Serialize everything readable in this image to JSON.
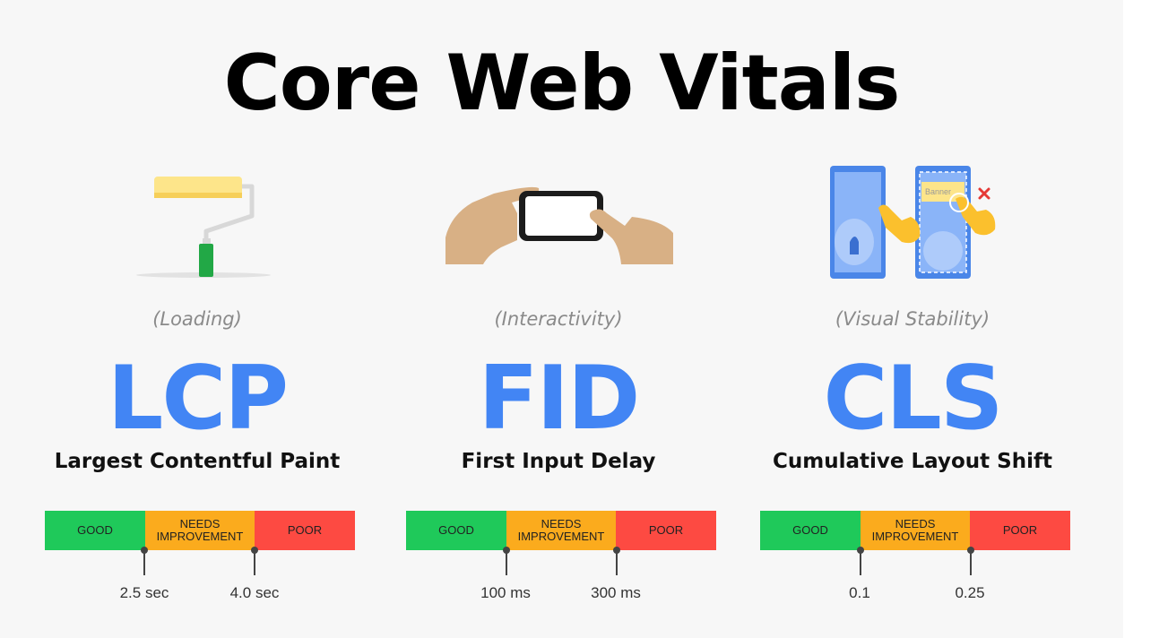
{
  "title": "Core Web Vitals",
  "colors": {
    "accent": "#4285f4",
    "good": "#1fc95a",
    "needs": "#fbab1d",
    "poor": "#fd4a42"
  },
  "bar_labels": {
    "good": "GOOD",
    "needs_1": "NEEDS",
    "needs_2": "IMPROVEMENT",
    "poor": "POOR"
  },
  "metrics": [
    {
      "category": "(Loading)",
      "acronym": "LCP",
      "name": "Largest Contentful Paint",
      "threshold_1": "2.5 sec",
      "threshold_2": "4.0 sec",
      "illustration": "paint-roller-icon"
    },
    {
      "category": "(Interactivity)",
      "acronym": "FID",
      "name": "First Input Delay",
      "threshold_1": "100 ms",
      "threshold_2": "300 ms",
      "illustration": "hand-tapping-phone-icon"
    },
    {
      "category": "(Visual Stability)",
      "acronym": "CLS",
      "name": "Cumulative Layout Shift",
      "threshold_1": "0.1",
      "threshold_2": "0.25",
      "illustration": "layout-shift-phones-icon",
      "banner_text": "Banner"
    }
  ]
}
